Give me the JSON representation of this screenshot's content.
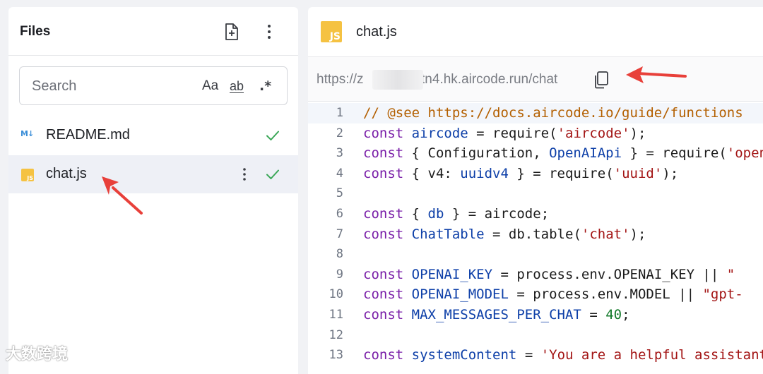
{
  "sidebar": {
    "title": "Files",
    "search": {
      "placeholder": "Search",
      "value": "",
      "opt_case": "Aa",
      "opt_word": "ab",
      "opt_regex": ".*"
    },
    "files": [
      {
        "name": "README.md",
        "icon": "markdown-icon",
        "status": "saved"
      },
      {
        "name": "chat.js",
        "icon": "javascript-icon",
        "status": "saved",
        "selected": true
      }
    ]
  },
  "editor": {
    "tab_title": "chat.js",
    "tab_icon_text": "JS",
    "url": "https://z        vtn4.hk.aircode.run/chat",
    "url_prefix": "https://z",
    "url_suffix": "vtn4.hk.aircode.run/chat",
    "active_line": 1,
    "lines": [
      {
        "num": "1",
        "text": "// @see https://docs.aircode.io/guide/functions"
      },
      {
        "num": "2",
        "text": "const aircode = require('aircode');"
      },
      {
        "num": "3",
        "text": "const { Configuration, OpenAIApi } = require('openai');"
      },
      {
        "num": "4",
        "text": "const { v4: uuidv4 } = require('uuid');"
      },
      {
        "num": "5",
        "text": ""
      },
      {
        "num": "6",
        "text": "const { db } = aircode;"
      },
      {
        "num": "7",
        "text": "const ChatTable = db.table('chat');"
      },
      {
        "num": "8",
        "text": ""
      },
      {
        "num": "9",
        "text": "const OPENAI_KEY = process.env.OPENAI_KEY || \""
      },
      {
        "num": "10",
        "text": "const OPENAI_MODEL = process.env.MODEL || \"gpt-"
      },
      {
        "num": "11",
        "text": "const MAX_MESSAGES_PER_CHAT = 40;"
      },
      {
        "num": "12",
        "text": ""
      },
      {
        "num": "13",
        "text": "const systemContent = 'You are a helpful assistant"
      }
    ]
  },
  "watermark": "大数跨境",
  "colors": {
    "keyword": "#7a1fa8",
    "variable": "#0d3fa8",
    "string": "#a31515",
    "comment": "#b35f00",
    "check": "#3aa757",
    "arrow": "#e8403a"
  }
}
